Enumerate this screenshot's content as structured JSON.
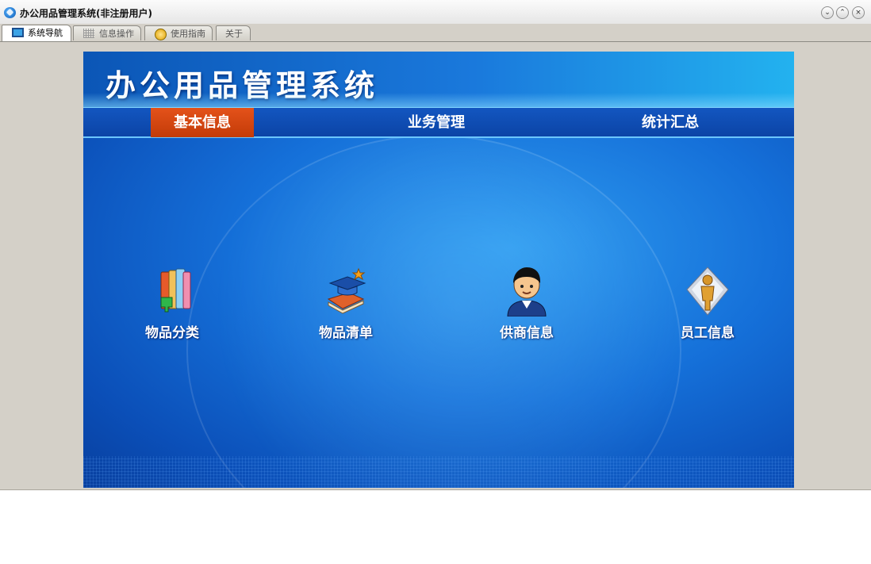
{
  "window": {
    "title": "办公用品管理系统(非注册用户)",
    "controls": {
      "minimize_icon": "chevron-down-icon",
      "maximize_icon": "chevron-up-icon",
      "close_icon": "close-icon"
    }
  },
  "tabs": [
    {
      "label": "系统导航",
      "icon": "monitor-icon",
      "active": true
    },
    {
      "label": "信息操作",
      "icon": "grid-icon",
      "active": false
    },
    {
      "label": "使用指南",
      "icon": "help-icon",
      "active": false
    },
    {
      "label": "关于",
      "icon": "",
      "active": false
    }
  ],
  "app": {
    "title": "办公用品管理系统",
    "nav": [
      {
        "label": "基本信息",
        "active": true
      },
      {
        "label": "业务管理",
        "active": false
      },
      {
        "label": "统计汇总",
        "active": false
      }
    ],
    "modules": [
      {
        "label": "物品分类",
        "icon": "books-icon"
      },
      {
        "label": "物品清单",
        "icon": "graduation-book-icon"
      },
      {
        "label": "供商信息",
        "icon": "person-icon"
      },
      {
        "label": "员工信息",
        "icon": "employee-icon"
      }
    ]
  },
  "colors": {
    "nav_active": "#d4460f",
    "panel_blue": "#1570d9",
    "window_bg": "#d4d0c8"
  }
}
